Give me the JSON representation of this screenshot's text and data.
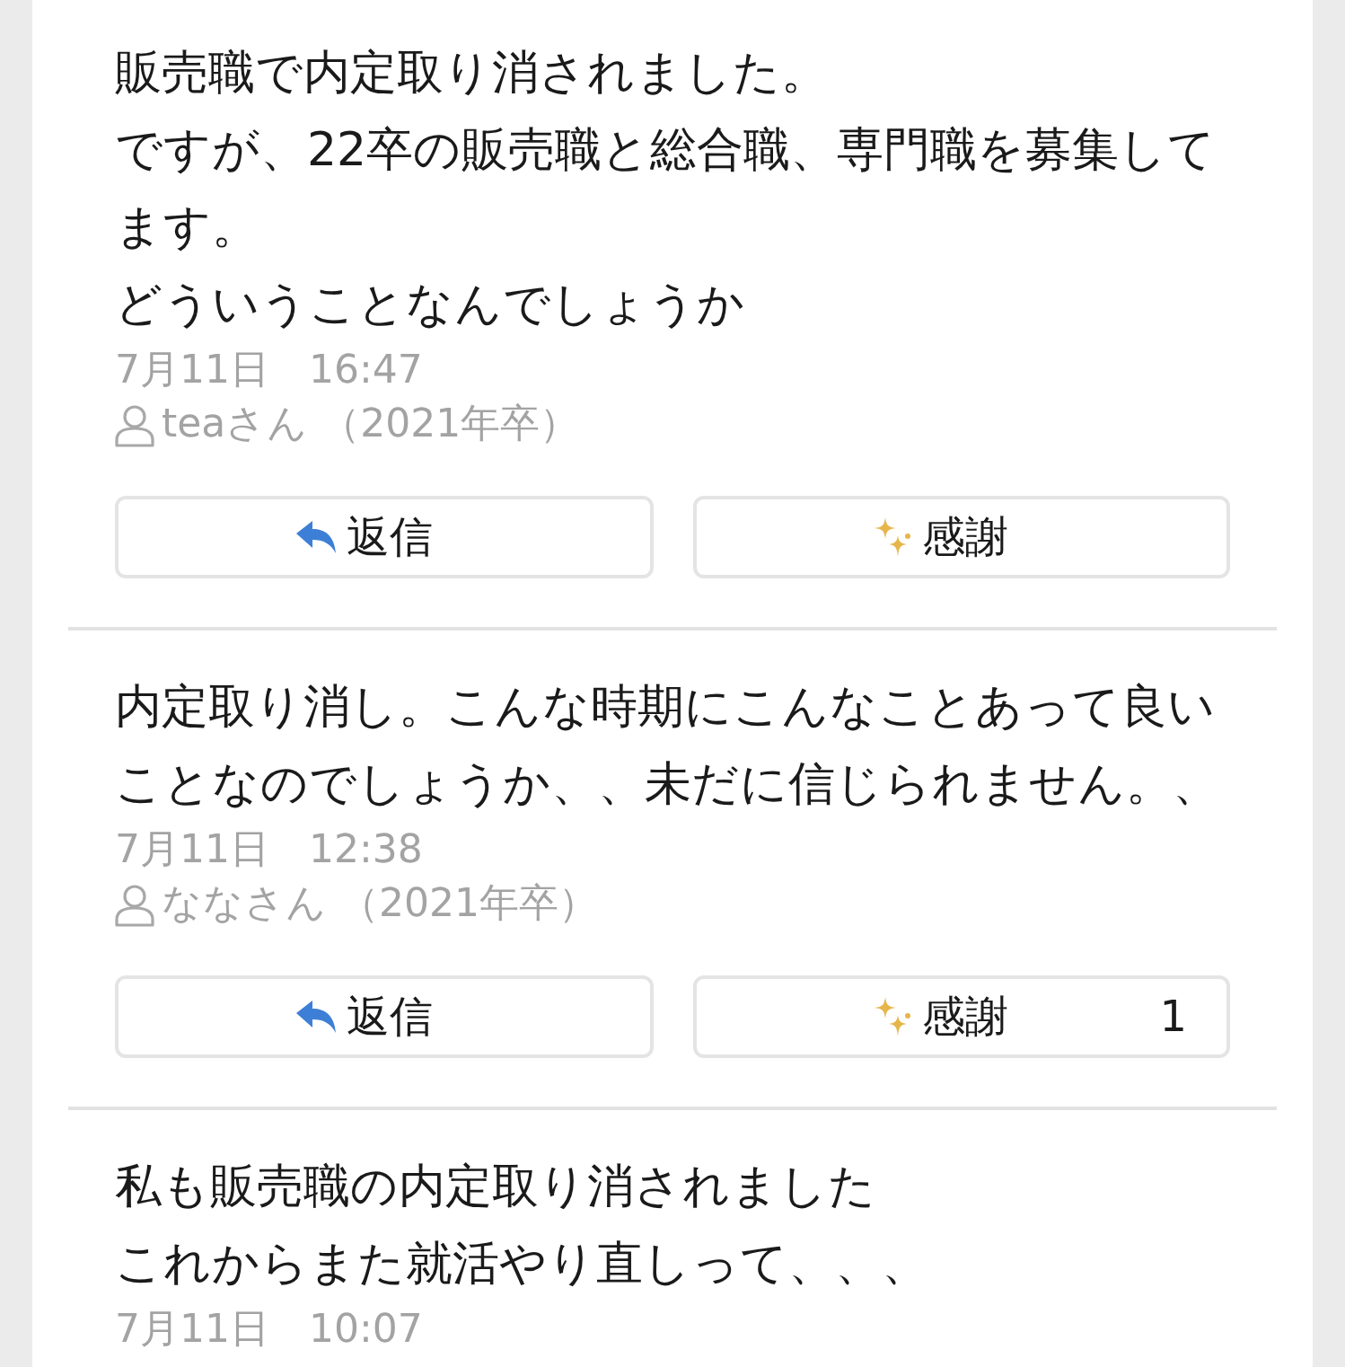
{
  "posts": [
    {
      "body": [
        "販売職で内定取り消されました。",
        "ですが、22卒の販売職と総合職、専門職を募集して",
        "ます。",
        "どういうことなんでしょうか"
      ],
      "date": "7月11日　16:47",
      "author": "teaさん （2021年卒）",
      "reply": {
        "label": "返信"
      },
      "thanks": {
        "label": "感謝"
      }
    },
    {
      "body": [
        "内定取り消し。こんな時期にこんなことあって良い",
        "ことなのでしょうか、、未だに信じられません。、"
      ],
      "date": "7月11日　12:38",
      "author": "ななさん （2021年卒）",
      "reply": {
        "label": "返信"
      },
      "thanks": {
        "label": "感謝",
        "count": "1"
      }
    },
    {
      "body": [
        "私も販売職の内定取り消されました",
        "これからまた就活やり直しって、、、"
      ],
      "date": "7月11日　10:07"
    }
  ]
}
